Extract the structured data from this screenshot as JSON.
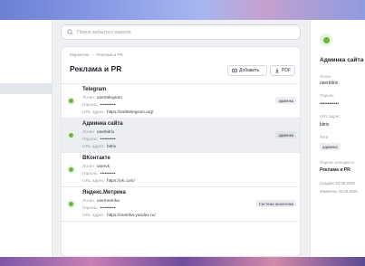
{
  "search": {
    "placeholder": "Поиск забытого пароля"
  },
  "breadcrumb": {
    "root": "Маркетинг",
    "separator": "›",
    "current": "Реклама и PR"
  },
  "page": {
    "title": "Реклама и PR"
  },
  "toolbar": {
    "add_label": "Добавить",
    "pdf_label": "PDF"
  },
  "field_labels": {
    "login": "Логин",
    "password": "Пароль",
    "url": "URL адрес"
  },
  "entries": [
    {
      "title": "Telegram",
      "login": "usertelegram",
      "password": "••••••••••",
      "url": "https://webtelegram.org/",
      "tag": "админка",
      "selected": false
    },
    {
      "title": "Админка сайта",
      "login": "userbitrix",
      "password": "••••••••••",
      "url": "bitrix",
      "tag": "админка",
      "selected": true
    },
    {
      "title": "ВКонтакте",
      "login": "uservk",
      "password": "••••••••••",
      "url": "https://vk.com/",
      "tag": "",
      "selected": false
    },
    {
      "title": "Яндекс.Метрика",
      "login": "usermetrika",
      "password": "••••••••••",
      "url": "https://metrika.yandex.ru/",
      "tag": "Система аналитики",
      "selected": false
    }
  ],
  "detail": {
    "title": "Админка сайта",
    "login_label": "Логин",
    "login": "userbitrix",
    "password_label": "Пароль",
    "password": "••••••••••••",
    "url_label": "URL адрес",
    "url": "bitrix",
    "tags_label": "Теги",
    "tag": "админка",
    "folder_label": "Пароль находится",
    "folder": "Реклама и PR",
    "created": "Создано 03.06.2025",
    "modified": "Изменено 23.06.2025"
  },
  "colors": {
    "accent_green": "#6cb33f",
    "selected_row": "#eceef1"
  }
}
